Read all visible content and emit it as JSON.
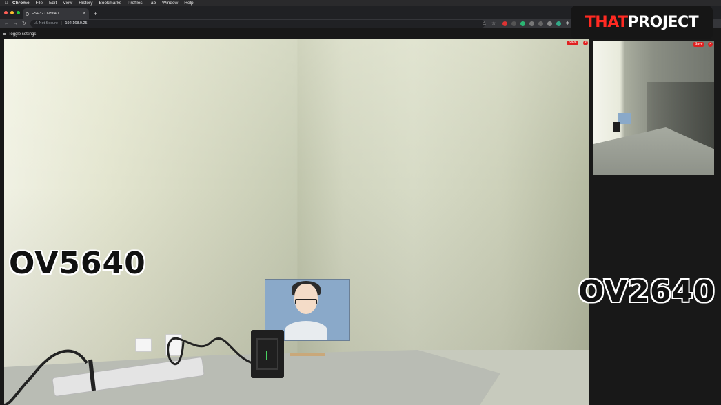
{
  "menubar": {
    "app_name": "Chrome",
    "items": [
      "File",
      "Edit",
      "View",
      "History",
      "Bookmarks",
      "Profiles",
      "Tab",
      "Window",
      "Help"
    ]
  },
  "browser": {
    "tab_title": "ESP32 OV5640",
    "tab_close": "×",
    "new_tab": "+",
    "security_label": "Not Secure",
    "url": "192.168.0.25"
  },
  "page": {
    "toggle_label": "Toggle settings",
    "main_stream": {
      "save_label": "Save",
      "close_label": "×"
    },
    "side_stream": {
      "save_label": "Save",
      "close_label": "×"
    }
  },
  "overlay": {
    "left_camera_label": "OV5640",
    "right_camera_label": "OV2640",
    "logo_part1": "THAT",
    "logo_part2": "PROJECT"
  },
  "colors": {
    "accent_red": "#e02020",
    "logo_red": "#ff2a22",
    "page_bg": "#181818"
  }
}
